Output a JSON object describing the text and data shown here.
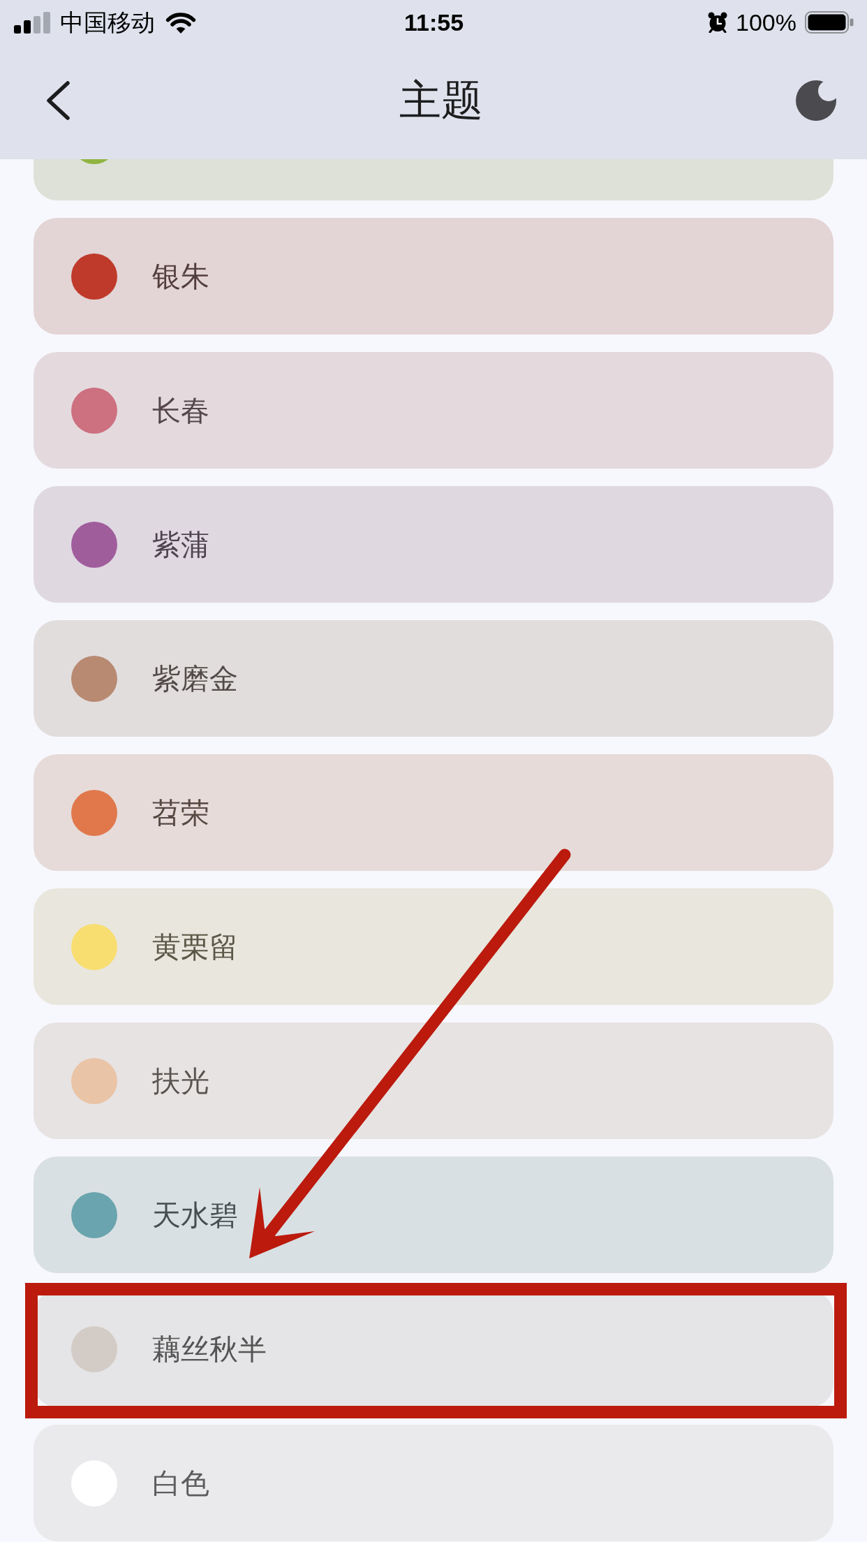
{
  "status_bar": {
    "carrier": "中国移动",
    "time": "11:55",
    "battery": "100%"
  },
  "nav_bar": {
    "title": "主题"
  },
  "themes": [
    {
      "kind": "cut_off",
      "color": "#8fb440",
      "highlighted": false
    },
    {
      "kind": "option",
      "name": "银朱",
      "color": "#bf3a2b",
      "highlighted": false
    },
    {
      "kind": "option",
      "name": "长春",
      "color": "#cd7080",
      "highlighted": false
    },
    {
      "kind": "option",
      "name": "紫蒲",
      "color": "#a05d9c",
      "highlighted": false
    },
    {
      "kind": "option",
      "name": "紫磨金",
      "color": "#b88a72",
      "highlighted": false
    },
    {
      "kind": "option",
      "name": "苕荣",
      "color": "#e0784c",
      "highlighted": false
    },
    {
      "kind": "option",
      "name": "黄栗留",
      "color": "#f8de70",
      "highlighted": false
    },
    {
      "kind": "option",
      "name": "扶光",
      "color": "#eac4a6",
      "highlighted": false
    },
    {
      "kind": "option",
      "name": "天水碧",
      "color": "#6aa4ae",
      "highlighted": false
    },
    {
      "kind": "option",
      "name": "藕丝秋半",
      "color": "#d3cbc5",
      "highlighted": true
    },
    {
      "kind": "option",
      "name": "白色",
      "color": "#ffffff",
      "highlighted": false
    }
  ]
}
